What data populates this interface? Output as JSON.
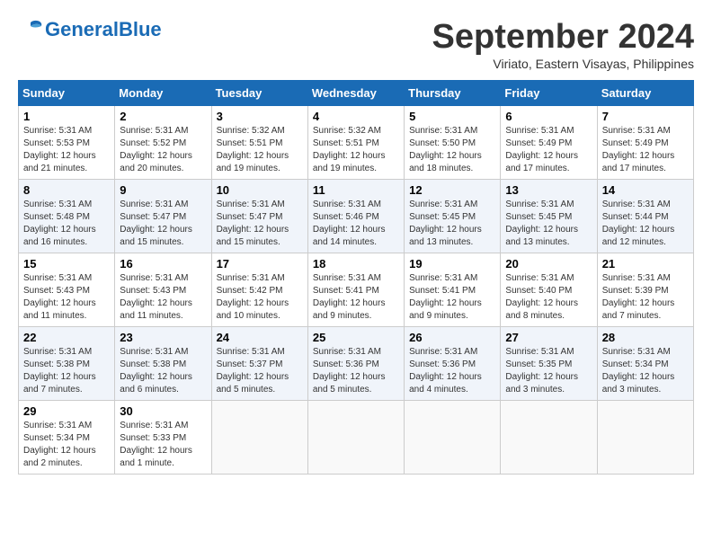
{
  "header": {
    "logo_general": "General",
    "logo_blue": "Blue",
    "month": "September 2024",
    "location": "Viriato, Eastern Visayas, Philippines"
  },
  "weekdays": [
    "Sunday",
    "Monday",
    "Tuesday",
    "Wednesday",
    "Thursday",
    "Friday",
    "Saturday"
  ],
  "weeks": [
    [
      {
        "day": "1",
        "sunrise": "5:31 AM",
        "sunset": "5:53 PM",
        "daylight": "12 hours and 21 minutes."
      },
      {
        "day": "2",
        "sunrise": "5:31 AM",
        "sunset": "5:52 PM",
        "daylight": "12 hours and 20 minutes."
      },
      {
        "day": "3",
        "sunrise": "5:32 AM",
        "sunset": "5:51 PM",
        "daylight": "12 hours and 19 minutes."
      },
      {
        "day": "4",
        "sunrise": "5:32 AM",
        "sunset": "5:51 PM",
        "daylight": "12 hours and 19 minutes."
      },
      {
        "day": "5",
        "sunrise": "5:31 AM",
        "sunset": "5:50 PM",
        "daylight": "12 hours and 18 minutes."
      },
      {
        "day": "6",
        "sunrise": "5:31 AM",
        "sunset": "5:49 PM",
        "daylight": "12 hours and 17 minutes."
      },
      {
        "day": "7",
        "sunrise": "5:31 AM",
        "sunset": "5:49 PM",
        "daylight": "12 hours and 17 minutes."
      }
    ],
    [
      {
        "day": "8",
        "sunrise": "5:31 AM",
        "sunset": "5:48 PM",
        "daylight": "12 hours and 16 minutes."
      },
      {
        "day": "9",
        "sunrise": "5:31 AM",
        "sunset": "5:47 PM",
        "daylight": "12 hours and 15 minutes."
      },
      {
        "day": "10",
        "sunrise": "5:31 AM",
        "sunset": "5:47 PM",
        "daylight": "12 hours and 15 minutes."
      },
      {
        "day": "11",
        "sunrise": "5:31 AM",
        "sunset": "5:46 PM",
        "daylight": "12 hours and 14 minutes."
      },
      {
        "day": "12",
        "sunrise": "5:31 AM",
        "sunset": "5:45 PM",
        "daylight": "12 hours and 13 minutes."
      },
      {
        "day": "13",
        "sunrise": "5:31 AM",
        "sunset": "5:45 PM",
        "daylight": "12 hours and 13 minutes."
      },
      {
        "day": "14",
        "sunrise": "5:31 AM",
        "sunset": "5:44 PM",
        "daylight": "12 hours and 12 minutes."
      }
    ],
    [
      {
        "day": "15",
        "sunrise": "5:31 AM",
        "sunset": "5:43 PM",
        "daylight": "12 hours and 11 minutes."
      },
      {
        "day": "16",
        "sunrise": "5:31 AM",
        "sunset": "5:43 PM",
        "daylight": "12 hours and 11 minutes."
      },
      {
        "day": "17",
        "sunrise": "5:31 AM",
        "sunset": "5:42 PM",
        "daylight": "12 hours and 10 minutes."
      },
      {
        "day": "18",
        "sunrise": "5:31 AM",
        "sunset": "5:41 PM",
        "daylight": "12 hours and 9 minutes."
      },
      {
        "day": "19",
        "sunrise": "5:31 AM",
        "sunset": "5:41 PM",
        "daylight": "12 hours and 9 minutes."
      },
      {
        "day": "20",
        "sunrise": "5:31 AM",
        "sunset": "5:40 PM",
        "daylight": "12 hours and 8 minutes."
      },
      {
        "day": "21",
        "sunrise": "5:31 AM",
        "sunset": "5:39 PM",
        "daylight": "12 hours and 7 minutes."
      }
    ],
    [
      {
        "day": "22",
        "sunrise": "5:31 AM",
        "sunset": "5:38 PM",
        "daylight": "12 hours and 7 minutes."
      },
      {
        "day": "23",
        "sunrise": "5:31 AM",
        "sunset": "5:38 PM",
        "daylight": "12 hours and 6 minutes."
      },
      {
        "day": "24",
        "sunrise": "5:31 AM",
        "sunset": "5:37 PM",
        "daylight": "12 hours and 5 minutes."
      },
      {
        "day": "25",
        "sunrise": "5:31 AM",
        "sunset": "5:36 PM",
        "daylight": "12 hours and 5 minutes."
      },
      {
        "day": "26",
        "sunrise": "5:31 AM",
        "sunset": "5:36 PM",
        "daylight": "12 hours and 4 minutes."
      },
      {
        "day": "27",
        "sunrise": "5:31 AM",
        "sunset": "5:35 PM",
        "daylight": "12 hours and 3 minutes."
      },
      {
        "day": "28",
        "sunrise": "5:31 AM",
        "sunset": "5:34 PM",
        "daylight": "12 hours and 3 minutes."
      }
    ],
    [
      {
        "day": "29",
        "sunrise": "5:31 AM",
        "sunset": "5:34 PM",
        "daylight": "12 hours and 2 minutes."
      },
      {
        "day": "30",
        "sunrise": "5:31 AM",
        "sunset": "5:33 PM",
        "daylight": "12 hours and 1 minute."
      },
      null,
      null,
      null,
      null,
      null
    ]
  ]
}
